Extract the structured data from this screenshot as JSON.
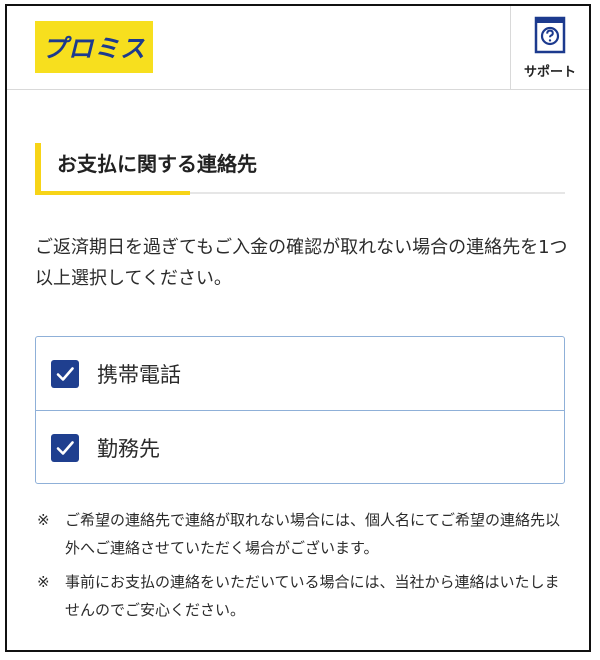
{
  "header": {
    "logo_text": "プロミス",
    "support_label": "サポート"
  },
  "section": {
    "title": "お支払に関する連絡先"
  },
  "description": "ご返済期日を過ぎてもご入金の確認が取れない場合の連絡先を1つ以上選択してください。",
  "checkboxes": [
    {
      "label": "携帯電話",
      "checked": true
    },
    {
      "label": "勤務先",
      "checked": true
    }
  ],
  "notes": [
    {
      "mark": "※",
      "text": "ご希望の連絡先で連絡が取れない場合には、個人名にてご希望の連絡先以外へご連絡させていただく場合がございます。"
    },
    {
      "mark": "※",
      "text": "事前にお支払の連絡をいただいている場合には、当社から連絡はいたしませんのでご安心ください。"
    }
  ],
  "colors": {
    "brand_yellow": "#f7df1e",
    "brand_navy": "#1c3a8e",
    "checkbox_blue": "#1f3f8f",
    "border_blue": "#8fb0d8"
  },
  "icons": {
    "support": "help-book-icon",
    "checkbox": "checkmark-icon"
  }
}
